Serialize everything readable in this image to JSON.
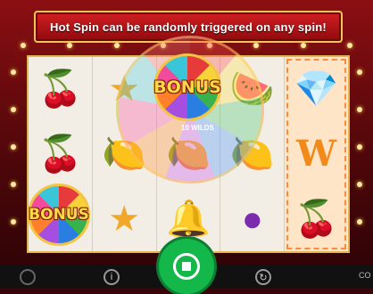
{
  "banner": {
    "text": "Hot Spin can be randomly triggered on any spin!"
  },
  "bonus_label": "BONUS",
  "wheel_label": "10 WILDS",
  "reels": [
    {
      "symbols": [
        "cherry-icon",
        "cherry-icon",
        "bonus-icon"
      ]
    },
    {
      "symbols": [
        "star-icon",
        "lemon-icon",
        "star-icon"
      ]
    },
    {
      "symbols": [
        "bonus-icon",
        "wheel-icon",
        "bell-icon"
      ]
    },
    {
      "symbols": [
        "watermelon-icon",
        "lemon-icon",
        "plum-icon"
      ]
    },
    {
      "symbols": [
        "diamond-icon",
        "wild-icon",
        "cherry-icon"
      ]
    }
  ],
  "controls": {
    "corner_text": "CO"
  },
  "colors": {
    "spin": "#14b84a",
    "banner": "#d21f22",
    "frame": "#8b0f12"
  }
}
